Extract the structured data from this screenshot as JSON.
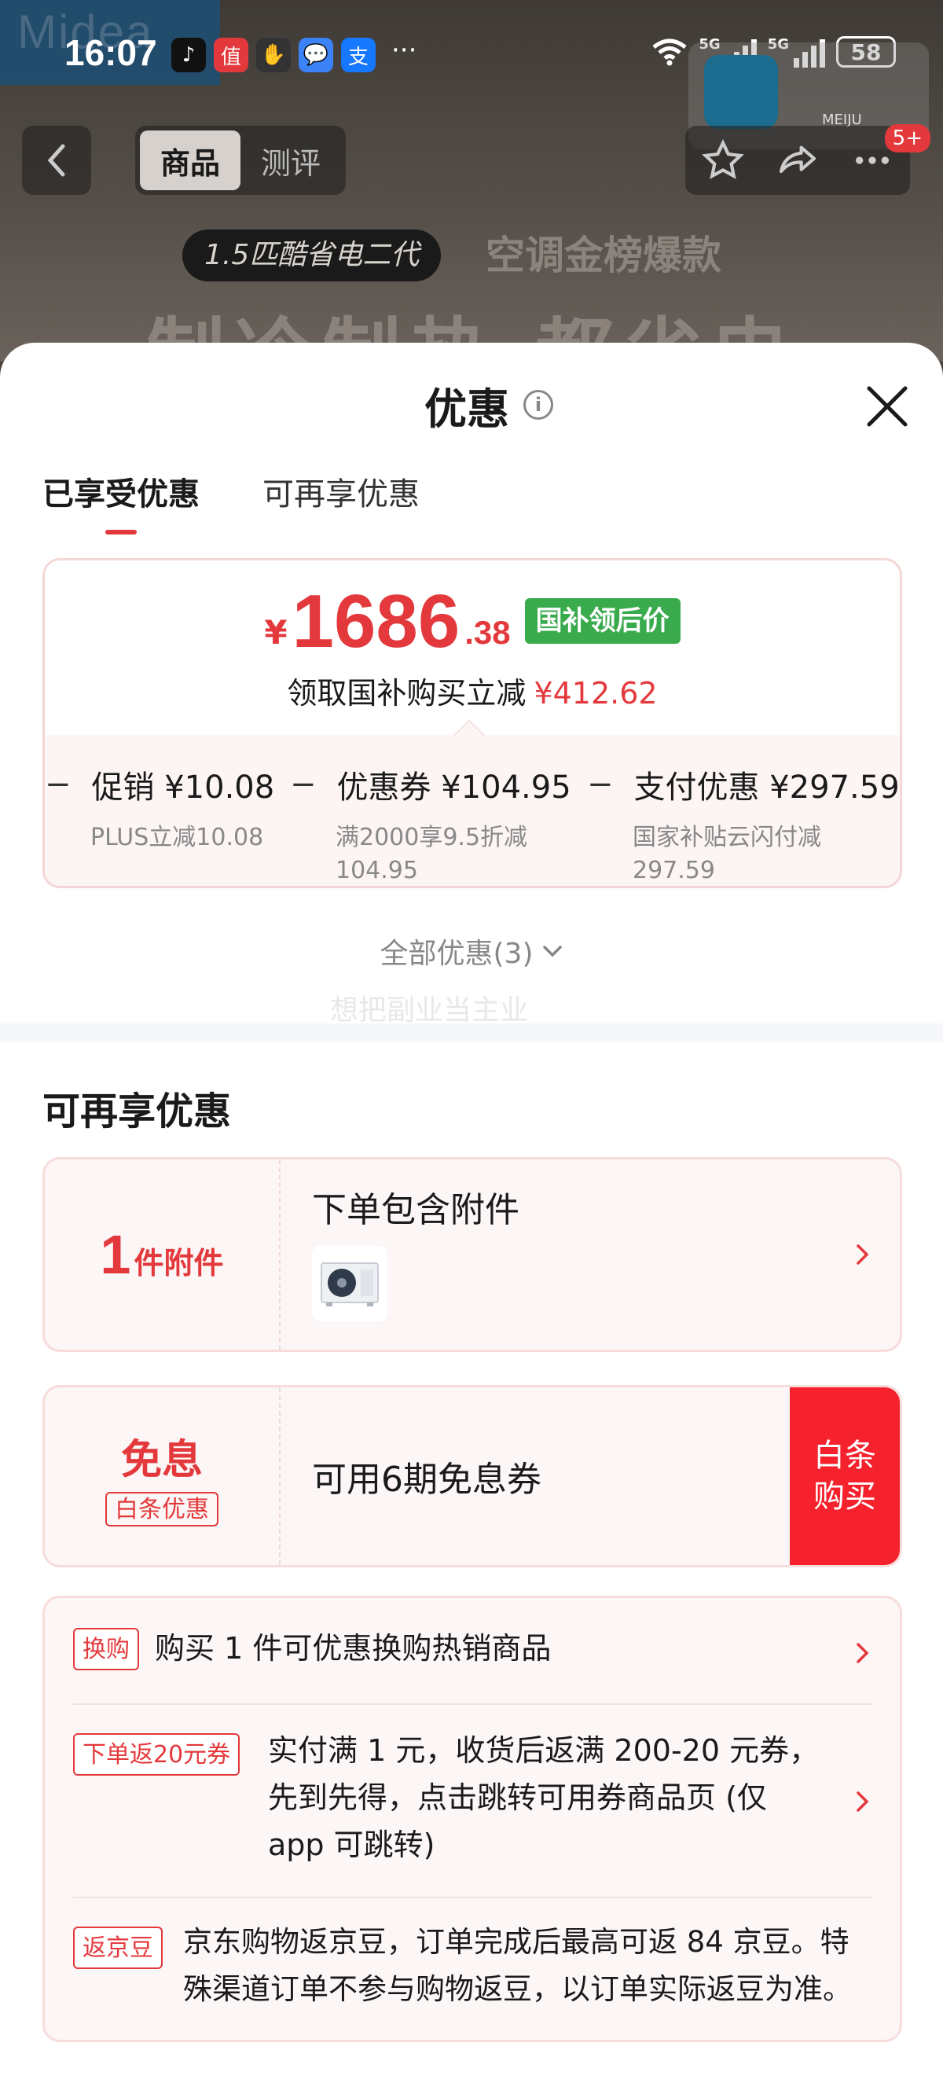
{
  "status_bar": {
    "time": "16:07",
    "network_1": "5G",
    "network_2": "5G",
    "battery": "58"
  },
  "background": {
    "logo_text": "Midea",
    "overlay_label": "MEIJU",
    "nav_tabs": [
      "商品",
      "测评"
    ],
    "badge": "5+",
    "promo_pill": "1.5匹酷省电二代",
    "promo_right": "空调金榜爆款",
    "promo_big": "制冷制热 都省电"
  },
  "sheet": {
    "title": "优惠",
    "tabs": [
      {
        "label": "已享受优惠",
        "active": true
      },
      {
        "label": "可再享优惠",
        "active": false
      }
    ],
    "price": {
      "currency": "¥",
      "integer": "1686",
      "decimal": ".38",
      "tag": "国补领后价",
      "sub_label": "领取国补购买立减",
      "sub_amount": "¥412.62"
    },
    "breakdown": [
      {
        "title": "促销 ¥10.08",
        "desc": [
          "PLUS立减10.08"
        ]
      },
      {
        "title": "优惠券 ¥104.95",
        "desc": [
          "满2000享9.5折减",
          "104.95"
        ]
      },
      {
        "title": "支付优惠 ¥297.59",
        "desc": [
          "国家补贴云闪付减",
          "297.59"
        ]
      }
    ],
    "all_offers": "全部优惠(3)",
    "watermark": "想把副业当主业",
    "section_title": "可再享优惠",
    "accessory": {
      "num": "1",
      "unit": "件附件",
      "title": "下单包含附件"
    },
    "interest_free": {
      "big": "免息",
      "tag": "白条优惠",
      "text": "可用6期免息券",
      "button_line1": "白条",
      "button_line2": "购买"
    },
    "list": [
      {
        "tag": "换购",
        "lines": [
          "购买 1 件可优惠换购热销商品"
        ],
        "chevron": true
      },
      {
        "tag": "下单返20元券",
        "lines": [
          "实付满 1 元，收货后返满 200-20 元券，",
          "先到先得，点击跳转可用券商品页 (仅",
          "app 可跳转)"
        ],
        "chevron": true
      },
      {
        "tag": "返京豆",
        "lines": [
          "京东购物返京豆，订单完成后最高可返 84 京豆。特",
          "殊渠道订单不参与购物返豆，以订单实际返豆为准。"
        ],
        "chevron": false
      }
    ],
    "colors": {
      "accent": "#e4393c",
      "green_tag": "#3aab4d",
      "baitiao": "#f5222d"
    }
  }
}
